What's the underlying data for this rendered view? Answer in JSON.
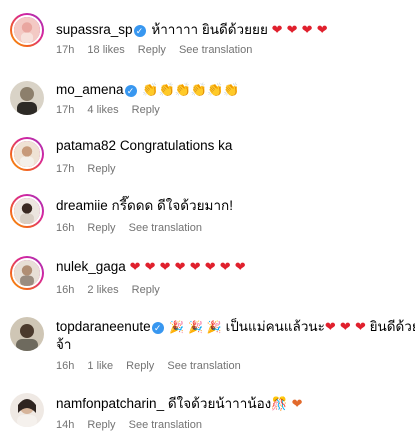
{
  "comments": [
    {
      "username": "supassra_sp",
      "verified": true,
      "text": "ห้าาาาา ยินดีด้วยยย",
      "emoji": "❤ ❤ ❤ ❤",
      "time": "17h",
      "likes": "18 likes",
      "reply": "Reply",
      "translate": "See translation"
    },
    {
      "username": "mo_amena",
      "verified": true,
      "text": "",
      "emoji": "👏👏👏👏👏👏",
      "time": "17h",
      "likes": "4 likes",
      "reply": "Reply"
    },
    {
      "username": "patama82",
      "verified": false,
      "text": "Congratulations ka",
      "time": "17h",
      "reply": "Reply"
    },
    {
      "username": "dreamiie",
      "verified": false,
      "text": "กรี๊ดดด ดีใจด้วยมาก!",
      "time": "16h",
      "reply": "Reply",
      "translate": "See translation"
    },
    {
      "username": "nulek_gaga",
      "verified": false,
      "text": "",
      "emoji": "❤ ❤ ❤ ❤ ❤ ❤ ❤ ❤",
      "time": "16h",
      "likes": "2 likes",
      "reply": "Reply"
    },
    {
      "username": "topdaraneenute",
      "verified": true,
      "emoji_lead": "🎉 🎉 🎉",
      "text": "เป็นแม่คนแล้วนะ",
      "emoji": "❤ ❤ ❤",
      "text_tail": "ยินดีด้วย",
      "text_line2": "จ้า",
      "time": "16h",
      "likes": "1 like",
      "reply": "Reply",
      "translate": "See translation"
    },
    {
      "username": "namfonpatcharin_",
      "verified": false,
      "text": "ดีใจด้วยน้าาาน้อง",
      "emoji": "🎊 ❤",
      "time": "14h",
      "reply": "Reply",
      "translate": "See translation"
    }
  ],
  "colors": {
    "meta_text": "#737373",
    "verified_badge": "#3897f0",
    "heart": "#e0202d",
    "story_ring": "#d6249f"
  },
  "icons": {
    "verified": "verified-badge-icon",
    "heart": "red-heart-emoji",
    "clap": "clapping-hands-emoji",
    "party": "party-popper-emoji"
  }
}
